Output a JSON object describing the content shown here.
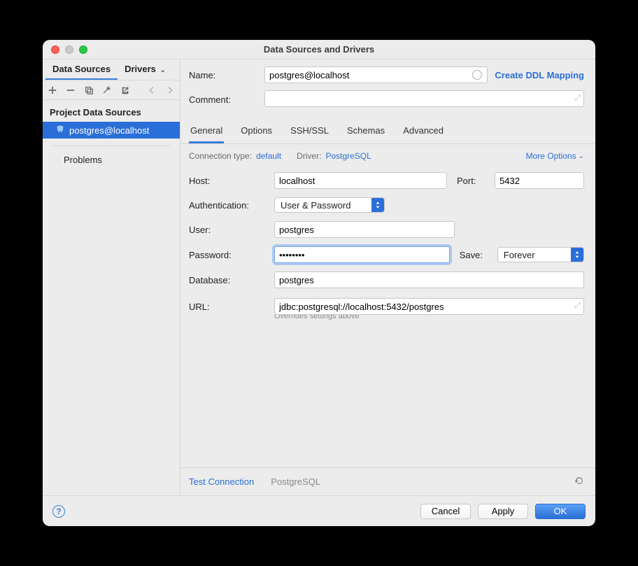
{
  "window_title": "Data Sources and Drivers",
  "sidebar": {
    "tabs": {
      "data_sources": "Data Sources",
      "drivers": "Drivers"
    },
    "section_header": "Project Data Sources",
    "items": [
      {
        "label": "postgres@localhost"
      }
    ],
    "problems": "Problems"
  },
  "form": {
    "name_label": "Name:",
    "name_value": "postgres@localhost",
    "ddl_link": "Create DDL Mapping",
    "comment_label": "Comment:",
    "comment_value": ""
  },
  "tabs": [
    "General",
    "Options",
    "SSH/SSL",
    "Schemas",
    "Advanced"
  ],
  "conn": {
    "type_label": "Connection type:",
    "type_value": "default",
    "driver_label": "Driver:",
    "driver_value": "PostgreSQL",
    "more_options": "More Options"
  },
  "fields": {
    "host_label": "Host:",
    "host_value": "localhost",
    "port_label": "Port:",
    "port_value": "5432",
    "auth_label": "Authentication:",
    "auth_value": "User & Password",
    "user_label": "User:",
    "user_value": "postgres",
    "password_label": "Password:",
    "password_value": "••••••••",
    "save_label": "Save:",
    "save_value": "Forever",
    "database_label": "Database:",
    "database_value": "postgres",
    "url_label": "URL:",
    "url_value": "jdbc:postgresql://localhost:5432/postgres",
    "url_hint": "Overrides settings above"
  },
  "bottom": {
    "test_connection": "Test Connection",
    "driver_shown": "PostgreSQL"
  },
  "footer": {
    "cancel": "Cancel",
    "apply": "Apply",
    "ok": "OK"
  }
}
